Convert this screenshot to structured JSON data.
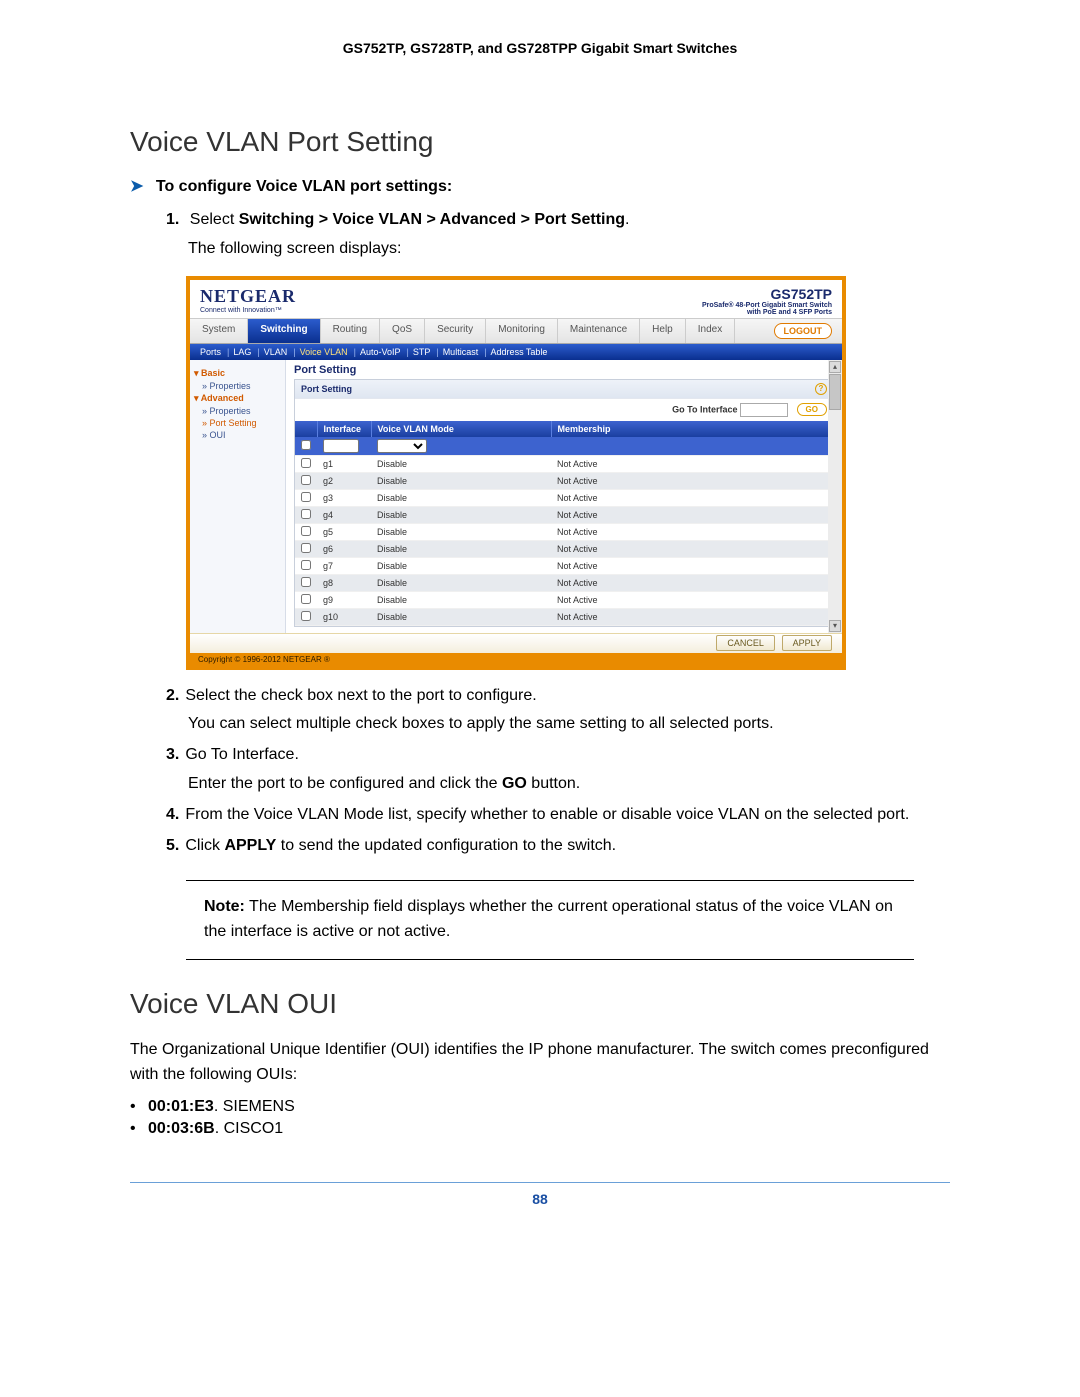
{
  "doc_header": "GS752TP, GS728TP, and GS728TPP Gigabit Smart Switches",
  "section1_title": "Voice VLAN Port Setting",
  "sub_head": "To configure Voice VLAN port settings:",
  "step1_prefix": "Select ",
  "step1_path": "Switching > Voice VLAN > Advanced > Port Setting",
  "step1_suffix": ".",
  "step1_follow": "The following screen displays:",
  "step2_a": "Select the check box next to the port to configure.",
  "step2_b": "You can select multiple check boxes to apply the same setting to all selected ports.",
  "step3_a": "Go To Interface.",
  "step3_b_pre": "Enter the port to be configured and click the ",
  "step3_b_bold": "GO",
  "step3_b_post": " button.",
  "step4": "From the Voice VLAN Mode list, specify whether to enable or disable voice VLAN on the selected port.",
  "step5_pre": "Click ",
  "step5_bold": "APPLY",
  "step5_post": " to send the updated configuration to the switch.",
  "note_label": "Note:",
  "note_text": " The Membership field displays whether the current operational status of the voice VLAN on the interface is active or not active.",
  "section2_title": "Voice VLAN OUI",
  "oui_intro": "The Organizational Unique Identifier (OUI) identifies the IP phone manufacturer. The switch comes preconfigured with the following OUIs:",
  "ouis": [
    {
      "code": "00:01:E3",
      "name": ". SIEMENS"
    },
    {
      "code": "00:03:6B",
      "name": ". CISCO1"
    }
  ],
  "page_number": "88",
  "shot": {
    "brand": "NETGEAR",
    "brand_sub": "Connect with Innovation™",
    "product": "GS752TP",
    "product_desc1": "ProSafe® 48-Port Gigabit Smart Switch",
    "product_desc2": "with PoE and 4 SFP Ports",
    "tabs": [
      "System",
      "Switching",
      "Routing",
      "QoS",
      "Security",
      "Monitoring",
      "Maintenance",
      "Help",
      "Index"
    ],
    "active_tab": "Switching",
    "logout": "LOGOUT",
    "subtabs": [
      "Ports",
      "LAG",
      "VLAN",
      "Voice VLAN",
      "Auto-VoIP",
      "STP",
      "Multicast",
      "Address Table"
    ],
    "active_subtab": "Voice VLAN",
    "sidebar": {
      "basic": "Basic",
      "basic_props": "» Properties",
      "advanced": "Advanced",
      "adv_props": "» Properties",
      "adv_port": "» Port Setting",
      "adv_oui": "» OUI"
    },
    "panel_title": "Port Setting",
    "panel_sub": "Port Setting",
    "goto_label": "Go To Interface",
    "go_btn": "GO",
    "columns": {
      "c1": "",
      "c2": "Interface",
      "c3": "Voice VLAN Mode",
      "c4": "Membership"
    },
    "rows": [
      {
        "iface": "g1",
        "mode": "Disable",
        "memb": "Not Active"
      },
      {
        "iface": "g2",
        "mode": "Disable",
        "memb": "Not Active"
      },
      {
        "iface": "g3",
        "mode": "Disable",
        "memb": "Not Active"
      },
      {
        "iface": "g4",
        "mode": "Disable",
        "memb": "Not Active"
      },
      {
        "iface": "g5",
        "mode": "Disable",
        "memb": "Not Active"
      },
      {
        "iface": "g6",
        "mode": "Disable",
        "memb": "Not Active"
      },
      {
        "iface": "g7",
        "mode": "Disable",
        "memb": "Not Active"
      },
      {
        "iface": "g8",
        "mode": "Disable",
        "memb": "Not Active"
      },
      {
        "iface": "g9",
        "mode": "Disable",
        "memb": "Not Active"
      },
      {
        "iface": "g10",
        "mode": "Disable",
        "memb": "Not Active"
      }
    ],
    "cancel": "CANCEL",
    "apply": "APPLY",
    "copyright": "Copyright © 1996-2012 NETGEAR ®"
  }
}
